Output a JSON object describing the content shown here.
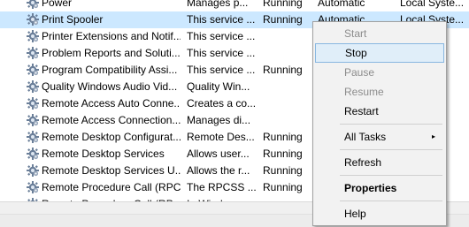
{
  "services": [
    {
      "name": "Power",
      "description": "Manages p...",
      "status": "Running",
      "startup": "Automatic",
      "logon": "Local Syste...",
      "selected": false
    },
    {
      "name": "Print Spooler",
      "description": "This service ...",
      "status": "Running",
      "startup": "Automatic",
      "logon": "Local Syste...",
      "selected": true
    },
    {
      "name": "Printer Extensions and Notif...",
      "description": "This service ...",
      "status": "",
      "startup": "",
      "logon": "",
      "selected": false
    },
    {
      "name": "Problem Reports and Soluti...",
      "description": "This service ...",
      "status": "",
      "startup": "",
      "logon": "",
      "selected": false
    },
    {
      "name": "Program Compatibility Assi...",
      "description": "This service ...",
      "status": "Running",
      "startup": "",
      "logon": "",
      "selected": false
    },
    {
      "name": "Quality Windows Audio Vid...",
      "description": "Quality Win...",
      "status": "",
      "startup": "",
      "logon": "",
      "selected": false
    },
    {
      "name": "Remote Access Auto Conne...",
      "description": "Creates a co...",
      "status": "",
      "startup": "",
      "logon": "",
      "selected": false
    },
    {
      "name": "Remote Access Connection...",
      "description": "Manages di...",
      "status": "",
      "startup": "",
      "logon": "",
      "selected": false
    },
    {
      "name": "Remote Desktop Configurat...",
      "description": "Remote Des...",
      "status": "Running",
      "startup": "",
      "logon": "",
      "selected": false
    },
    {
      "name": "Remote Desktop Services",
      "description": "Allows user...",
      "status": "Running",
      "startup": "",
      "logon": "",
      "selected": false
    },
    {
      "name": "Remote Desktop Services U...",
      "description": "Allows the r...",
      "status": "Running",
      "startup": "",
      "logon": "",
      "selected": false
    },
    {
      "name": "Remote Procedure Call (RPC)",
      "description": "The RPCSS ...",
      "status": "Running",
      "startup": "",
      "logon": "",
      "selected": false
    },
    {
      "name": "Remote Procedure Call (RP...",
      "description": "In Windo...",
      "status": "",
      "startup": "",
      "logon": "",
      "selected": false
    }
  ],
  "context_menu": {
    "items": [
      {
        "label": "Start",
        "disabled": true,
        "hover": false,
        "bold": false,
        "submenu": false
      },
      {
        "label": "Stop",
        "disabled": false,
        "hover": true,
        "bold": false,
        "submenu": false
      },
      {
        "label": "Pause",
        "disabled": true,
        "hover": false,
        "bold": false,
        "submenu": false
      },
      {
        "label": "Resume",
        "disabled": true,
        "hover": false,
        "bold": false,
        "submenu": false
      },
      {
        "label": "Restart",
        "disabled": false,
        "hover": false,
        "bold": false,
        "submenu": false
      },
      {
        "separator": true
      },
      {
        "label": "All Tasks",
        "disabled": false,
        "hover": false,
        "bold": false,
        "submenu": true
      },
      {
        "separator": true
      },
      {
        "label": "Refresh",
        "disabled": false,
        "hover": false,
        "bold": false,
        "submenu": false
      },
      {
        "separator": true
      },
      {
        "label": "Properties",
        "disabled": false,
        "hover": false,
        "bold": true,
        "submenu": false
      },
      {
        "separator": true
      },
      {
        "label": "Help",
        "disabled": false,
        "hover": false,
        "bold": false,
        "submenu": false
      }
    ],
    "submenu_arrow": "▸"
  },
  "colors": {
    "selected_row": "#cce8ff",
    "menu_hover": "#e0eef9",
    "menu_hover_border": "#88b7e0",
    "disabled_text": "#8c8c8c"
  },
  "icons": {
    "service": "gear-icon"
  }
}
